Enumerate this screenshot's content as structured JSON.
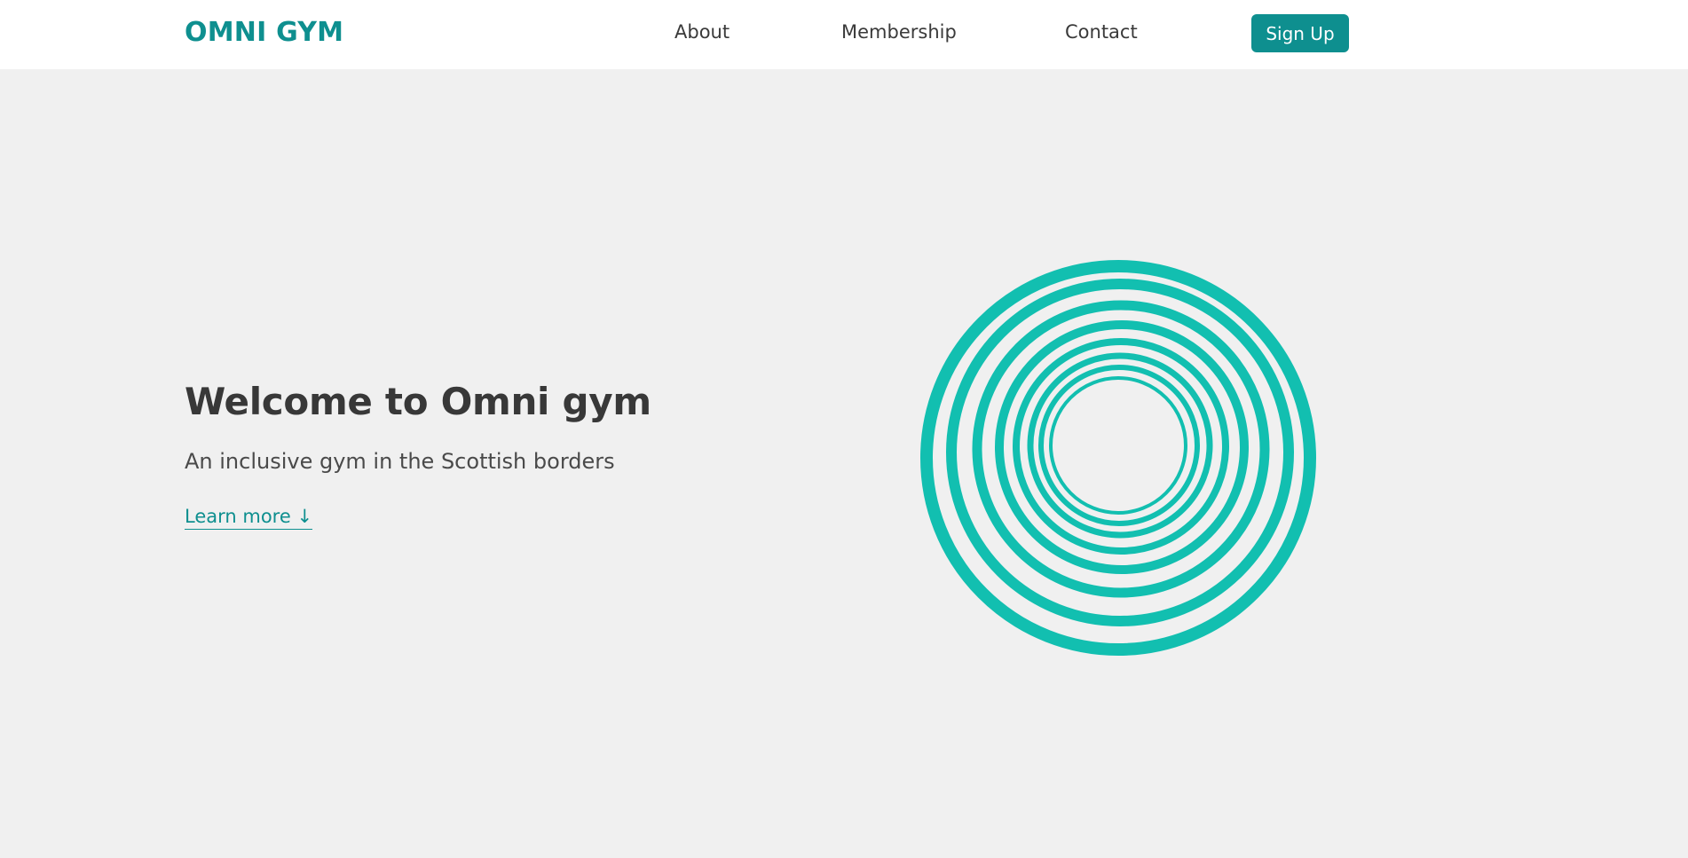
{
  "header": {
    "brand": "OMNI GYM",
    "nav": {
      "about": "About",
      "membership": "Membership",
      "contact": "Contact"
    },
    "signup_label": "Sign Up"
  },
  "hero": {
    "title": "Welcome to Omni gym",
    "subtitle": "An inclusive gym in the Scottish borders",
    "learn_more": "Learn more ↓"
  },
  "colors": {
    "brand": "#0e8f8f",
    "rings": "#12bfb0",
    "background": "#f0f0f0",
    "header_bg": "#ffffff"
  },
  "icons": {
    "hero_graphic": "concentric-rings-graphic"
  }
}
